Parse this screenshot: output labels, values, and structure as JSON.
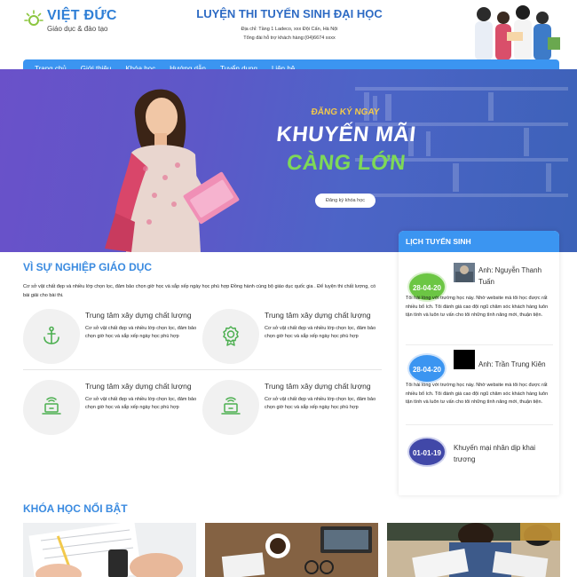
{
  "header": {
    "logo_title": "VIỆT ĐỨC",
    "logo_subtitle": "Giáo dục & đào tạo",
    "site_title": "LUYỆN THI TUYỂN SINH ĐẠI HỌC",
    "address": "Địa chỉ: Tầng 1 Ladeco, xxx Đội Cấn, Hà Nội",
    "hotline": "Tổng đài hỗ trợ khách hàng:(04)6674 xxxx"
  },
  "nav": {
    "items": [
      "Trang chủ",
      "Giới thiệu",
      "Khóa học",
      "Hướng dẫn",
      "Tuyển dụng",
      "Liên hệ"
    ]
  },
  "hero": {
    "kicker": "ĐĂNG KÝ NGAY",
    "line1": "KHUYẾN MÃI",
    "line2": "CÀNG LỚN",
    "button": "Đăng ký khóa học"
  },
  "about": {
    "title": "VÌ SỰ NGHIỆP GIÁO DỤC",
    "description": "Cơ sở vật chất đẹp và nhiều lớp chọn lọc, đảm bảo chọn giờ học và sắp xếp ngày học phù hợp Đồng hành cùng bộ giáo dục quốc gia . Để luyện thi chất lượng, có bài giải cho bài thi.",
    "features": [
      {
        "title": "Trung tâm xây dựng chất lượng",
        "desc": "Cơ sở vật chất đẹp và nhiều lớp chọn lọc, đảm bảo chọn giờ học và sắp xếp ngày học phù hợp",
        "icon": "anchor-icon"
      },
      {
        "title": "Trung tâm xây dựng chất lượng",
        "desc": "Cơ sở vật chất đẹp và nhiều lớp chọn lọc, đảm bảo chọn giờ học và sắp xếp ngày học phù hợp",
        "icon": "award-badge-icon"
      },
      {
        "title": "Trung tâm xây dựng chất lượng",
        "desc": "Cơ sở vật chất đẹp và nhiều lớp chọn lọc, đảm bảo chọn giờ học và sắp xếp ngày học phù hợp",
        "icon": "laptop-wifi-icon"
      },
      {
        "title": "Trung tâm xây dựng chất lượng",
        "desc": "Cơ sở vật chất đẹp và nhiều lớp chọn lọc, đảm bảo chọn giờ học và sắp xếp ngày học phù hợp",
        "icon": "laptop-wifi-icon"
      }
    ]
  },
  "schedule": {
    "title": "LỊCH TUYỂN SINH",
    "events": [
      {
        "date": "28-04-20",
        "name": "Anh: Nguyễn Thanh Tuấn",
        "text": "Tôi hài lòng với trường học này. Nhờ website mà tôi học được rất nhiều bổ ích. Tôi đánh giá cao đội ngũ chăm sóc khách hàng luôn tận tình và luôn tư vấn cho tôi những tình năng mới, thuận tiện.",
        "color": "#6cc644"
      },
      {
        "date": "28-04-20",
        "name": "Anh: Trần Trung Kiên",
        "text": "Tôi hài lòng với trường học này. Nhờ website mà tôi học được rất nhiều bổ ích. Tôi đánh giá cao đội ngũ chăm sóc khách hàng luôn tận tình và luôn tư vấn cho tôi những tình năng mới, thuận tiện.",
        "color": "#3b95f1"
      },
      {
        "date": "01-01-19",
        "name": "Khuyến mại nhân dịp khai trương",
        "text": "",
        "color": "#4148a8"
      }
    ]
  },
  "courses": {
    "title": "KHÓA HỌC NỔI BẬT"
  },
  "colors": {
    "accent": "#3b95f1",
    "green": "#6cc644",
    "title_blue": "#2e6bc4"
  }
}
